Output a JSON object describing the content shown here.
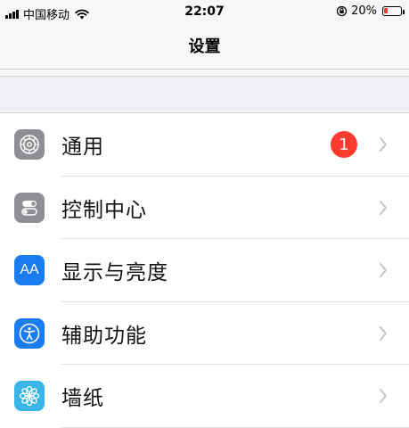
{
  "status_bar": {
    "carrier": "中国移动",
    "time": "22:07",
    "battery_text": "20%",
    "battery_level": 0.2,
    "icons": [
      "signal-icon",
      "wifi-icon",
      "rotation-lock-icon",
      "battery-icon"
    ]
  },
  "nav": {
    "title": "设置"
  },
  "settings": {
    "items": [
      {
        "label": "通用",
        "icon": "gear-icon",
        "badge": "1"
      },
      {
        "label": "控制中心",
        "icon": "toggle-switches-icon"
      },
      {
        "label": "显示与亮度",
        "icon": "display-aa-icon",
        "icon_text": "AA"
      },
      {
        "label": "辅助功能",
        "icon": "accessibility-icon"
      },
      {
        "label": "墙纸",
        "icon": "flower-icon"
      }
    ]
  },
  "colors": {
    "badge": "#ff3b30",
    "gray_icon": "#8e8e93",
    "blue_icon": "#1a7cf0",
    "wallpaper_icon": "#3ab5e8"
  }
}
